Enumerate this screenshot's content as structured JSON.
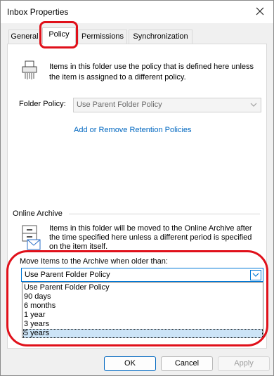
{
  "window": {
    "title": "Inbox Properties"
  },
  "tabs": [
    {
      "label": "General"
    },
    {
      "label": "Policy"
    },
    {
      "label": "Permissions"
    },
    {
      "label": "Synchronization"
    }
  ],
  "policy": {
    "description": "Items in this folder use the policy that is defined here unless the item is assigned to a different policy.",
    "folder_policy_label": "Folder Policy:",
    "folder_policy_value": "Use Parent Folder Policy",
    "retention_link": "Add or Remove Retention Policies"
  },
  "archive": {
    "group_label": "Online Archive",
    "description": "Items in this folder will be moved to the Online Archive after the time specified here unless a different period is specified on the item itself.",
    "move_label": "Move Items to the Archive when older than:",
    "selected_value": "Use Parent Folder Policy",
    "options": [
      "Use Parent Folder Policy",
      "90 days",
      "6 months",
      "1 year",
      "3 years",
      "5 years"
    ],
    "highlighted_option": "5 years"
  },
  "buttons": {
    "ok": "OK",
    "cancel": "Cancel",
    "apply": "Apply"
  },
  "icons": {
    "close": "close-icon",
    "retention": "shredder-icon",
    "archive": "archive-box-icon",
    "dropdown": "chevron-down-icon"
  },
  "colors": {
    "annotation": "#e0101a",
    "selection": "#cce4f7",
    "link": "#0067c0"
  }
}
